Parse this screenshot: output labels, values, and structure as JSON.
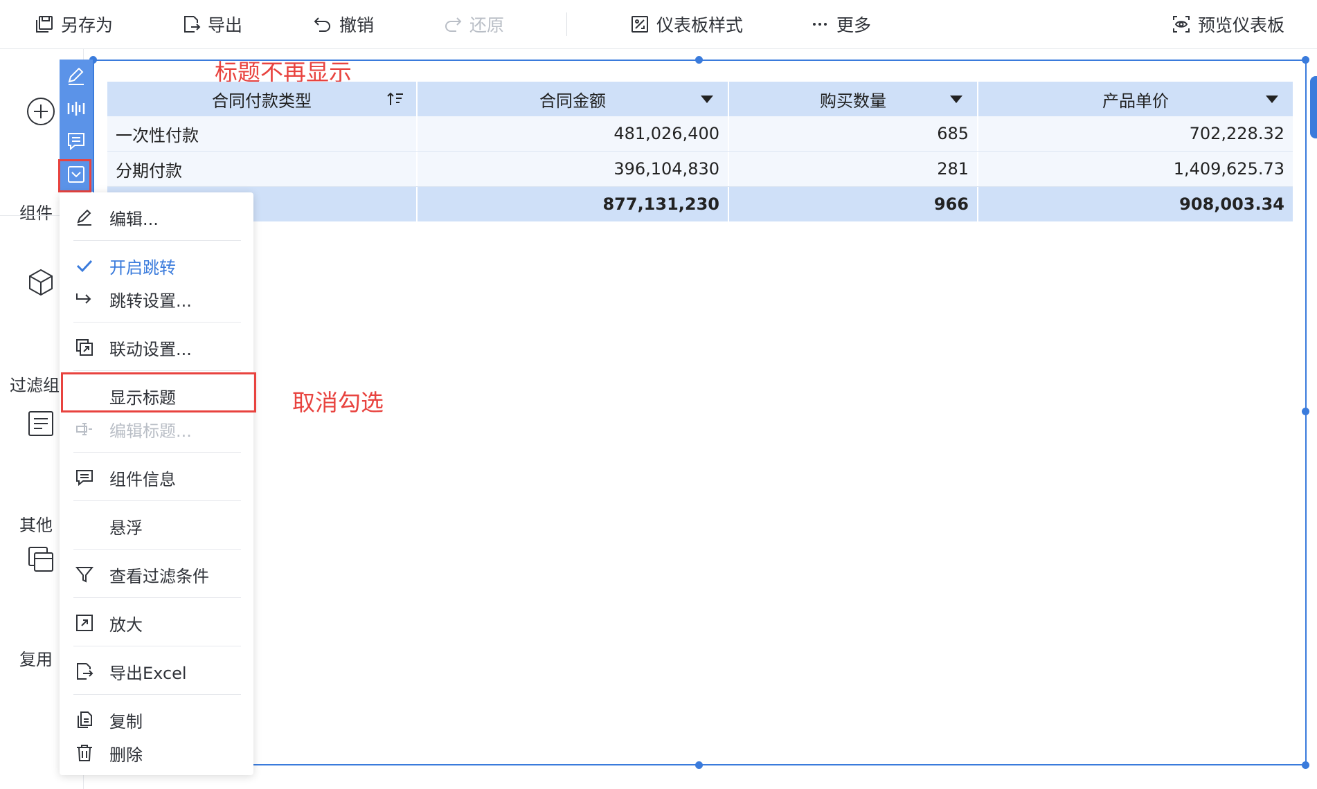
{
  "toolbar": {
    "save_as": "另存为",
    "export": "导出",
    "undo": "撤销",
    "redo": "还原",
    "dashboard_style": "仪表板样式",
    "more": "更多",
    "preview": "预览仪表板"
  },
  "sidebar": {
    "components": "组件",
    "filter_components": "过滤组",
    "other": "其他",
    "reuse": "复用"
  },
  "annotations": {
    "title_hidden": "标题不再显示",
    "uncheck": "取消勾选"
  },
  "table": {
    "headers": [
      "合同付款类型",
      "合同金额",
      "购买数量",
      "产品单价"
    ],
    "rows": [
      [
        "一次性付款",
        "481,026,400",
        "685",
        "702,228.32"
      ],
      [
        "分期付款",
        "396,104,830",
        "281",
        "1,409,625.73"
      ]
    ],
    "total": [
      "",
      "877,131,230",
      "966",
      "908,003.34"
    ]
  },
  "menu": {
    "edit": "编辑...",
    "enable_jump": "开启跳转",
    "jump_settings": "跳转设置...",
    "linkage_settings": "联动设置...",
    "show_title": "显示标题",
    "edit_title": "编辑标题...",
    "component_info": "组件信息",
    "float": "悬浮",
    "view_filters": "查看过滤条件",
    "zoom": "放大",
    "export_excel": "导出Excel",
    "copy": "复制",
    "delete": "删除"
  },
  "colors": {
    "accent": "#3a7bdc",
    "annotation": "#e8433f",
    "header_bg": "#cfe0f8",
    "tool_strip": "#5b93e8"
  }
}
